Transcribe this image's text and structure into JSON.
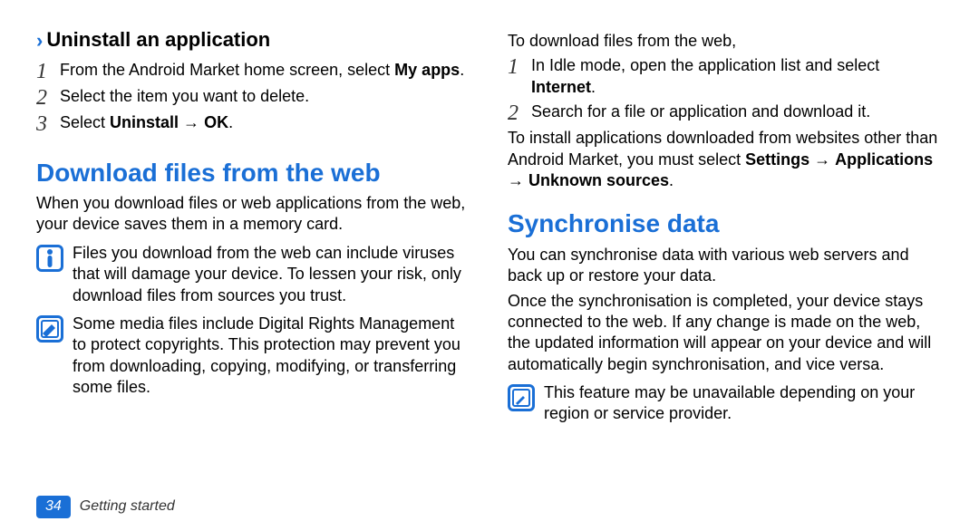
{
  "left": {
    "uninstall_heading": "Uninstall an application",
    "steps": [
      {
        "num": "1",
        "html": "From the Android Market home screen, select <b>My apps</b>."
      },
      {
        "num": "2",
        "html": "Select the item you want to delete."
      },
      {
        "num": "3",
        "html": "Select <b>Uninstall</b> → <b>OK</b>."
      }
    ],
    "download_heading": "Download files from the web",
    "download_para": "When you download files or web applications from the web, your device saves them in a memory card.",
    "warn_text": "Files you download from the web can include viruses that will damage your device. To lessen your risk, only download files from sources you trust.",
    "note_text": "Some media files include Digital Rights Management to protect copyrights. This protection may prevent you from downloading, copying, modifying, or transferring some files."
  },
  "right": {
    "intro": "To download files from the web,",
    "steps": [
      {
        "num": "1",
        "html": "In Idle mode, open the application list and select <b>Internet</b>."
      },
      {
        "num": "2",
        "html": "Search for a file or application and download it."
      }
    ],
    "install_note_html": "To install applications downloaded from websites other than Android Market, you must select <b>Settings</b> → <b>Applications</b> → <b>Unknown sources</b>.",
    "sync_heading": "Synchronise data",
    "sync_para1": "You can synchronise data with various web servers and back up or restore your data.",
    "sync_para2": "Once the synchronisation is completed, your device stays connected to the web. If any change is made on the web, the updated information will appear on your device and will automatically begin synchronisation, and vice versa.",
    "sync_note": "This feature may be unavailable depending on your region or service provider."
  },
  "footer": {
    "page": "34",
    "section": "Getting started"
  }
}
